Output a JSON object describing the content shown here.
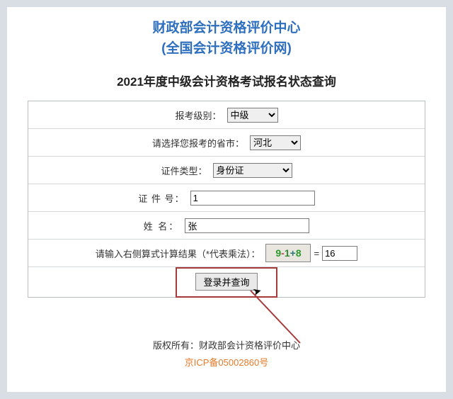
{
  "header": {
    "line1": "财政部会计资格评价中心",
    "line2": "(全国会计资格评价网)"
  },
  "subtitle": "2021年度中级会计资格考试报名状态查询",
  "form": {
    "level_label": "报考级别：",
    "level_selected": "中级",
    "province_label": "请选择您报考的省市：",
    "province_selected": "河北",
    "idtype_label": "证件类型：",
    "idtype_selected": "身份证",
    "idnum_label": "证 件 号：",
    "idnum_value": "1",
    "name_label": "姓  名：",
    "name_value": "张",
    "captcha_label": "请输入右侧算式计算结果（*代表乘法）：",
    "captcha_expr": "9-1+8",
    "captcha_equals": "=",
    "captcha_value": "16",
    "submit_label": "登录并查询"
  },
  "footer": {
    "copyright": "版权所有：财政部会计资格评价中心",
    "icp": "京ICP备05002860号"
  }
}
